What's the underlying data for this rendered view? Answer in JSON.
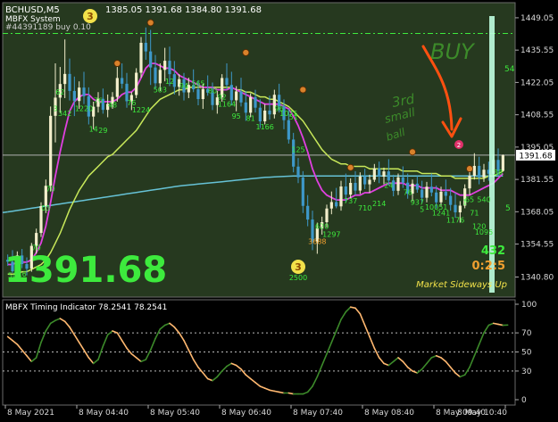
{
  "header": {
    "symbol": "BCHUSD,M5",
    "ohlc": "1385.05 1391.68 1384.80 1391.68",
    "system_name": "MBFX System",
    "order": "#44391189 buy 0.10"
  },
  "price_panel": {
    "big_price": "1391.68",
    "current_price_tag": "1391.68",
    "y_ticks": [
      "1449.05",
      "1435.55",
      "1422.05",
      "1408.55",
      "1395.05",
      "1381.55",
      "1368.05",
      "1354.55",
      "1340.80"
    ],
    "ylim": [
      1338,
      1452
    ],
    "x_count": 105,
    "current_price": 1391.68,
    "order_line": 1442.5,
    "right_edge_fragments": [
      "54",
      "5"
    ],
    "status_text": "Market Sideways Up",
    "counter_green": "432",
    "counter_orange": "0:2:5",
    "colors": {
      "bg": "#26391f",
      "bull": "#f3efcc",
      "bear": "#3d98c9",
      "wick": "#f3efcc",
      "magenta": "#e040e0",
      "yellowgreen": "#c8e85a",
      "cyan": "#66c2d6",
      "green_label": "#3dea3d"
    }
  },
  "annotations": {
    "buy_text": "BUY",
    "note_line1": "3rd",
    "note_line2": "small",
    "note_line3": "ball",
    "badge_top": "3",
    "badge_bottom": "3",
    "badge_bottom_label": "2500",
    "pink_dot": "2"
  },
  "number_labels": [
    {
      "i": 1,
      "v": 1340.5,
      "t": "50",
      "c": "green"
    },
    {
      "i": 2,
      "v": 1342.5,
      "t": "8",
      "c": "green"
    },
    {
      "i": 3,
      "v": 1341.0,
      "t": "16",
      "c": "green"
    },
    {
      "i": 6,
      "v": 1352.0,
      "t": "70",
      "c": "green"
    },
    {
      "i": 8,
      "v": 1368.5,
      "t": "03",
      "c": "green"
    },
    {
      "i": 9,
      "v": 1376.5,
      "t": "70",
      "c": "green"
    },
    {
      "i": 10,
      "v": 1410.0,
      "t": "3",
      "c": "green"
    },
    {
      "i": 11,
      "v": 1417.0,
      "t": "62",
      "c": "green"
    },
    {
      "i": 12,
      "v": 1408.0,
      "t": "342",
      "c": "green"
    },
    {
      "i": 16,
      "v": 1410.0,
      "t": "1220",
      "c": "green"
    },
    {
      "i": 18,
      "v": 1401.5,
      "t": "14",
      "c": "green"
    },
    {
      "i": 20,
      "v": 1401.0,
      "t": "29",
      "c": "green"
    },
    {
      "i": 19,
      "v": 1413.5,
      "t": "76",
      "c": "green"
    },
    {
      "i": 22,
      "v": 1411.5,
      "t": "48",
      "c": "green"
    },
    {
      "i": 26,
      "v": 1412.5,
      "t": "76",
      "c": "green"
    },
    {
      "i": 28,
      "v": 1409.5,
      "t": "1224",
      "c": "green"
    },
    {
      "i": 32,
      "v": 1418.0,
      "t": "503",
      "c": "green"
    },
    {
      "i": 34,
      "v": 1421.5,
      "t": "12",
      "c": "green"
    },
    {
      "i": 37,
      "v": 1419.5,
      "t": "94",
      "c": "green"
    },
    {
      "i": 40,
      "v": 1420.5,
      "t": "565",
      "c": "green"
    },
    {
      "i": 43,
      "v": 1417.5,
      "t": "80",
      "c": "green"
    },
    {
      "i": 45,
      "v": 1415.0,
      "t": "92",
      "c": "green"
    },
    {
      "i": 46,
      "v": 1412.0,
      "t": "1164",
      "c": "green"
    },
    {
      "i": 48,
      "v": 1407.0,
      "t": "95",
      "c": "green"
    },
    {
      "i": 51,
      "v": 1406.0,
      "t": "81",
      "c": "green"
    },
    {
      "i": 54,
      "v": 1402.5,
      "t": "1166",
      "c": "green"
    },
    {
      "i": 57,
      "v": 1410.0,
      "t": "96",
      "c": "green"
    },
    {
      "i": 59,
      "v": 1408.0,
      "t": "1075",
      "c": "green"
    },
    {
      "i": 60,
      "v": 1406.5,
      "t": "51",
      "c": "green"
    },
    {
      "i": 61,
      "v": 1393.0,
      "t": "125",
      "c": "green"
    },
    {
      "i": 66,
      "v": 1361.0,
      "t": "620",
      "c": "green"
    },
    {
      "i": 68,
      "v": 1357.5,
      "t": "1297",
      "c": "green"
    },
    {
      "i": 65,
      "v": 1354.5,
      "t": "3688",
      "c": "orange"
    },
    {
      "i": 72,
      "v": 1371.5,
      "t": "737",
      "c": "green"
    },
    {
      "i": 75,
      "v": 1368.5,
      "t": "710",
      "c": "green"
    },
    {
      "i": 78,
      "v": 1370.5,
      "t": "214",
      "c": "green"
    },
    {
      "i": 80,
      "v": 1378.0,
      "t": "24",
      "c": "green"
    },
    {
      "i": 84,
      "v": 1375.0,
      "t": "76",
      "c": "green"
    },
    {
      "i": 86,
      "v": 1371.0,
      "t": "937",
      "c": "green"
    },
    {
      "i": 87,
      "v": 1368.0,
      "t": "5",
      "c": "green"
    },
    {
      "i": 90,
      "v": 1369.0,
      "t": "10051",
      "c": "green"
    },
    {
      "i": 91,
      "v": 1366.5,
      "t": "1241",
      "c": "green"
    },
    {
      "i": 94,
      "v": 1363.5,
      "t": "1176",
      "c": "green"
    },
    {
      "i": 96,
      "v": 1371.0,
      "t": "1",
      "c": "green"
    },
    {
      "i": 97,
      "v": 1372.0,
      "t": "65",
      "c": "green"
    },
    {
      "i": 98,
      "v": 1366.5,
      "t": "71",
      "c": "green"
    },
    {
      "i": 100,
      "v": 1372.0,
      "t": "540",
      "c": "green"
    },
    {
      "i": 99,
      "v": 1361.0,
      "t": "120",
      "c": "green"
    },
    {
      "i": 100,
      "v": 1358.5,
      "t": "1095",
      "c": "green"
    },
    {
      "i": 103,
      "v": 1383.5,
      "t": "38",
      "c": "green"
    }
  ],
  "orange_dots": [
    {
      "i": 30,
      "v": 1447.0
    },
    {
      "i": 23,
      "v": 1430.0
    },
    {
      "i": 50,
      "v": 1434.5
    },
    {
      "i": 62,
      "v": 1419.0
    },
    {
      "i": 72,
      "v": 1386.5
    },
    {
      "i": 97,
      "v": 1386.0
    },
    {
      "i": 85,
      "v": 1393.0
    }
  ],
  "candles": [
    [
      1348.0,
      1350.2,
      1345.5,
      1347.2
    ],
    [
      1347.2,
      1352.0,
      1342.5,
      1343.2
    ],
    [
      1343.2,
      1351.5,
      1342.8,
      1349.8
    ],
    [
      1349.8,
      1352.5,
      1344.5,
      1346.2
    ],
    [
      1346.2,
      1349.0,
      1341.5,
      1344.3
    ],
    [
      1344.3,
      1355.0,
      1343.0,
      1353.8
    ],
    [
      1353.8,
      1361.0,
      1350.5,
      1359.2
    ],
    [
      1359.2,
      1372.0,
      1357.5,
      1370.4
    ],
    [
      1370.4,
      1381.5,
      1367.5,
      1378.9
    ],
    [
      1378.9,
      1412.0,
      1376.5,
      1408.1
    ],
    [
      1408.1,
      1430.0,
      1397.0,
      1415.7
    ],
    [
      1415.7,
      1428.5,
      1409.5,
      1421.4
    ],
    [
      1421.4,
      1440.0,
      1415.5,
      1425.6
    ],
    [
      1425.6,
      1432.0,
      1414.5,
      1418.5
    ],
    [
      1418.5,
      1424.5,
      1408.0,
      1414.3
    ],
    [
      1414.3,
      1422.5,
      1411.0,
      1419.9
    ],
    [
      1419.9,
      1426.5,
      1413.0,
      1416.3
    ],
    [
      1416.3,
      1420.0,
      1404.5,
      1407.8
    ],
    [
      1407.8,
      1414.0,
      1402.5,
      1411.9
    ],
    [
      1411.9,
      1418.0,
      1409.5,
      1415.2
    ],
    [
      1415.2,
      1419.5,
      1409.0,
      1410.6
    ],
    [
      1410.6,
      1417.0,
      1407.5,
      1413.1
    ],
    [
      1413.1,
      1418.0,
      1411.0,
      1416.0
    ],
    [
      1416.0,
      1428.5,
      1414.0,
      1423.9
    ],
    [
      1423.9,
      1430.0,
      1419.5,
      1421.5
    ],
    [
      1421.5,
      1426.0,
      1411.5,
      1414.2
    ],
    [
      1414.2,
      1418.0,
      1410.5,
      1416.8
    ],
    [
      1416.8,
      1428.0,
      1415.5,
      1426.1
    ],
    [
      1426.1,
      1441.0,
      1424.0,
      1438.6
    ],
    [
      1438.6,
      1445.0,
      1431.5,
      1435.0
    ],
    [
      1435.0,
      1444.0,
      1421.0,
      1428.3
    ],
    [
      1428.3,
      1433.5,
      1419.5,
      1421.7
    ],
    [
      1421.7,
      1430.0,
      1418.5,
      1427.3
    ],
    [
      1427.3,
      1436.5,
      1422.5,
      1431.1
    ],
    [
      1431.1,
      1437.0,
      1420.5,
      1425.5
    ],
    [
      1425.5,
      1431.0,
      1417.0,
      1420.2
    ],
    [
      1420.2,
      1425.5,
      1416.5,
      1423.4
    ],
    [
      1423.4,
      1426.0,
      1414.5,
      1417.9
    ],
    [
      1417.9,
      1424.0,
      1415.5,
      1421.0
    ],
    [
      1421.0,
      1427.5,
      1418.0,
      1419.2
    ],
    [
      1419.2,
      1423.0,
      1412.5,
      1415.1
    ],
    [
      1415.1,
      1421.5,
      1411.0,
      1419.3
    ],
    [
      1419.3,
      1425.0,
      1416.5,
      1417.8
    ],
    [
      1417.8,
      1422.0,
      1410.5,
      1412.6
    ],
    [
      1412.6,
      1418.5,
      1409.0,
      1415.8
    ],
    [
      1415.8,
      1425.5,
      1414.0,
      1423.9
    ],
    [
      1423.9,
      1430.0,
      1419.0,
      1421.0
    ],
    [
      1421.0,
      1426.5,
      1412.5,
      1414.6
    ],
    [
      1414.6,
      1420.5,
      1410.0,
      1418.3
    ],
    [
      1418.3,
      1424.0,
      1412.0,
      1413.7
    ],
    [
      1413.7,
      1418.5,
      1406.0,
      1409.4
    ],
    [
      1409.4,
      1417.5,
      1407.5,
      1415.9
    ],
    [
      1415.9,
      1419.0,
      1409.5,
      1411.5
    ],
    [
      1411.5,
      1415.0,
      1403.0,
      1405.8
    ],
    [
      1405.8,
      1413.0,
      1404.5,
      1410.3
    ],
    [
      1410.3,
      1416.5,
      1406.5,
      1408.7
    ],
    [
      1408.7,
      1419.0,
      1407.0,
      1416.9
    ],
    [
      1416.9,
      1421.5,
      1409.5,
      1412.1
    ],
    [
      1412.1,
      1415.0,
      1402.5,
      1406.3
    ],
    [
      1406.3,
      1411.0,
      1396.5,
      1398.2
    ],
    [
      1398.2,
      1401.0,
      1384.5,
      1386.9
    ],
    [
      1386.9,
      1390.5,
      1380.0,
      1382.4
    ],
    [
      1382.4,
      1385.0,
      1367.5,
      1370.5
    ],
    [
      1370.5,
      1375.0,
      1362.0,
      1364.8
    ],
    [
      1364.8,
      1368.5,
      1352.0,
      1355.6
    ],
    [
      1355.6,
      1363.5,
      1350.5,
      1361.2
    ],
    [
      1361.2,
      1366.0,
      1358.5,
      1363.7
    ],
    [
      1363.7,
      1371.0,
      1361.5,
      1369.4
    ],
    [
      1369.4,
      1376.5,
      1367.0,
      1372.1
    ],
    [
      1372.1,
      1378.0,
      1369.5,
      1370.3
    ],
    [
      1370.3,
      1381.0,
      1368.5,
      1378.6
    ],
    [
      1378.6,
      1384.0,
      1372.0,
      1375.2
    ],
    [
      1375.2,
      1382.0,
      1373.5,
      1380.1
    ],
    [
      1380.1,
      1385.0,
      1375.0,
      1376.9
    ],
    [
      1376.9,
      1384.5,
      1375.5,
      1382.8
    ],
    [
      1382.8,
      1386.0,
      1377.5,
      1379.5
    ],
    [
      1379.5,
      1383.5,
      1376.0,
      1381.4
    ],
    [
      1381.4,
      1388.0,
      1380.5,
      1386.2
    ],
    [
      1386.2,
      1389.0,
      1380.0,
      1382.7
    ],
    [
      1382.7,
      1386.5,
      1379.5,
      1384.9
    ],
    [
      1384.9,
      1390.0,
      1379.0,
      1381.1
    ],
    [
      1381.1,
      1383.5,
      1374.5,
      1376.8
    ],
    [
      1376.8,
      1384.0,
      1375.0,
      1382.4
    ],
    [
      1382.4,
      1387.0,
      1378.0,
      1380.2
    ],
    [
      1380.2,
      1384.0,
      1373.5,
      1375.6
    ],
    [
      1375.6,
      1381.5,
      1372.5,
      1379.8
    ],
    [
      1379.8,
      1383.0,
      1376.0,
      1377.3
    ],
    [
      1377.3,
      1381.0,
      1371.5,
      1373.9
    ],
    [
      1373.9,
      1380.5,
      1372.0,
      1378.5
    ],
    [
      1378.5,
      1384.0,
      1374.5,
      1376.1
    ],
    [
      1376.1,
      1379.0,
      1369.5,
      1372.0
    ],
    [
      1372.0,
      1378.5,
      1370.5,
      1376.4
    ],
    [
      1376.4,
      1381.5,
      1373.0,
      1374.7
    ],
    [
      1374.7,
      1378.0,
      1368.5,
      1370.9
    ],
    [
      1370.9,
      1376.0,
      1365.5,
      1367.8
    ],
    [
      1367.8,
      1372.5,
      1363.5,
      1370.6
    ],
    [
      1370.6,
      1379.5,
      1369.5,
      1377.8
    ],
    [
      1377.8,
      1385.5,
      1375.0,
      1383.1
    ],
    [
      1383.1,
      1392.5,
      1381.5,
      1387.2
    ],
    [
      1387.2,
      1391.0,
      1379.5,
      1382.4
    ],
    [
      1382.4,
      1388.0,
      1380.5,
      1385.6
    ],
    [
      1385.6,
      1389.0,
      1381.0,
      1383.9
    ],
    [
      1383.9,
      1392.0,
      1382.5,
      1389.7
    ],
    [
      1389.7,
      1394.5,
      1383.0,
      1385.1
    ],
    [
      1385.1,
      1392.0,
      1384.8,
      1391.68
    ]
  ],
  "lines": {
    "magenta": [
      1346,
      1346,
      1347,
      1347,
      1347,
      1348,
      1351,
      1355,
      1362,
      1372,
      1383,
      1393,
      1402,
      1410,
      1414,
      1416,
      1417,
      1417,
      1415,
      1414,
      1414,
      1414,
      1414,
      1415,
      1417,
      1418,
      1418,
      1420,
      1424,
      1428,
      1430,
      1430,
      1429,
      1428,
      1428,
      1427,
      1425,
      1424,
      1423,
      1422,
      1421,
      1420,
      1420,
      1420,
      1419,
      1419,
      1419,
      1420,
      1419,
      1418,
      1417,
      1416,
      1415,
      1414,
      1413,
      1413,
      1413,
      1413,
      1412,
      1411,
      1408,
      1404,
      1399,
      1393,
      1386,
      1381,
      1377,
      1375,
      1374,
      1373,
      1373,
      1373,
      1374,
      1375,
      1375,
      1376,
      1376,
      1377,
      1378,
      1379,
      1380,
      1380,
      1380,
      1380,
      1379,
      1379,
      1379,
      1378,
      1378,
      1378,
      1378,
      1377,
      1377,
      1377,
      1376,
      1375,
      1375,
      1375,
      1376,
      1377,
      1378,
      1379,
      1380,
      1382,
      1384
    ],
    "yellowgreen": [
      1342,
      1342,
      1342,
      1343,
      1343,
      1344,
      1345,
      1346,
      1348,
      1351,
      1355,
      1359,
      1364,
      1369,
      1373,
      1377,
      1380,
      1383,
      1385,
      1387,
      1389,
      1391,
      1392,
      1394,
      1396,
      1398,
      1400,
      1402,
      1405,
      1408,
      1411,
      1413,
      1415,
      1416,
      1417,
      1418,
      1419,
      1419,
      1420,
      1420,
      1420,
      1420,
      1420,
      1420,
      1420,
      1420,
      1420,
      1420,
      1419,
      1419,
      1418,
      1418,
      1417,
      1416,
      1416,
      1415,
      1415,
      1414,
      1413,
      1412,
      1410,
      1408,
      1406,
      1403,
      1400,
      1397,
      1394,
      1392,
      1390,
      1389,
      1388,
      1388,
      1387,
      1387,
      1387,
      1387,
      1386,
      1386,
      1386,
      1386,
      1386,
      1386,
      1386,
      1385,
      1385,
      1385,
      1385,
      1384,
      1384,
      1384,
      1384,
      1383,
      1383,
      1383,
      1382,
      1382,
      1382,
      1382,
      1382,
      1382,
      1382,
      1383,
      1383,
      1384,
      1385
    ],
    "cyan": [
      1368.0,
      1368.3,
      1368.6,
      1368.9,
      1369.2,
      1369.5,
      1369.8,
      1370.1,
      1370.4,
      1370.7,
      1371.0,
      1371.3,
      1371.6,
      1371.9,
      1372.2,
      1372.5,
      1372.8,
      1373.1,
      1373.4,
      1373.7,
      1374.0,
      1374.3,
      1374.6,
      1374.9,
      1375.2,
      1375.5,
      1375.8,
      1376.1,
      1376.4,
      1376.7,
      1377.0,
      1377.3,
      1377.6,
      1377.9,
      1378.2,
      1378.5,
      1378.8,
      1379.0,
      1379.2,
      1379.4,
      1379.6,
      1379.8,
      1380.0,
      1380.2,
      1380.4,
      1380.6,
      1380.8,
      1381.0,
      1381.2,
      1381.4,
      1381.6,
      1381.8,
      1382.0,
      1382.2,
      1382.4,
      1382.5,
      1382.6,
      1382.7,
      1382.8,
      1382.9,
      1383.0,
      1383.0,
      1383.0,
      1383.0,
      1383.0,
      1383.0,
      1383.0,
      1383.0,
      1383.0,
      1383.0,
      1383.0,
      1383.0,
      1383.0,
      1383.0,
      1383.0,
      1383.0,
      1383.0,
      1383.0,
      1383.0,
      1383.0,
      1383.0,
      1383.0,
      1383.0,
      1383.0,
      1383.0,
      1383.0,
      1383.0,
      1383.0,
      1383.0,
      1383.0,
      1383.0,
      1383.0,
      1383.0,
      1383.0,
      1383.0,
      1383.0,
      1383.0,
      1383.0,
      1383.0,
      1383.0,
      1383.0,
      1383.0,
      1383.0,
      1383.0,
      1383.0
    ]
  },
  "timing_panel": {
    "title": "MBFX Timing Indicator 78.2541 78.2541",
    "y_ticks": [
      "100",
      "70",
      "50",
      "30",
      "0"
    ],
    "ylim": [
      0,
      100
    ],
    "levels": [
      70,
      50,
      30
    ],
    "colors": {
      "up": "#3c8a2a",
      "down": "#ffb870",
      "level": "#bbbbbb"
    },
    "values": [
      66,
      62,
      58,
      52,
      46,
      40,
      44,
      60,
      72,
      80,
      83,
      85,
      82,
      76,
      68,
      60,
      52,
      44,
      38,
      42,
      56,
      68,
      72,
      70,
      62,
      54,
      48,
      44,
      40,
      42,
      52,
      64,
      74,
      78,
      80,
      76,
      70,
      62,
      52,
      42,
      34,
      28,
      22,
      20,
      24,
      30,
      35,
      38,
      36,
      32,
      26,
      22,
      18,
      14,
      12,
      10,
      9,
      8,
      7,
      7,
      6,
      6,
      6,
      8,
      14,
      24,
      36,
      48,
      60,
      72,
      84,
      92,
      97,
      96,
      90,
      78,
      66,
      54,
      44,
      38,
      36,
      40,
      44,
      40,
      34,
      30,
      28,
      32,
      38,
      44,
      46,
      44,
      40,
      34,
      28,
      24,
      26,
      34,
      46,
      58,
      70,
      78,
      80,
      79,
      78,
      78.25
    ]
  },
  "time_axis": {
    "labels": [
      "8 May 2021",
      "8 May 04:40",
      "8 May 05:40",
      "8 May 06:40",
      "8 May 07:40",
      "8 May 08:40",
      "8 May 09:40",
      "8 May 10:40"
    ],
    "positions": [
      0,
      15,
      30,
      45,
      60,
      75,
      90,
      105
    ]
  }
}
